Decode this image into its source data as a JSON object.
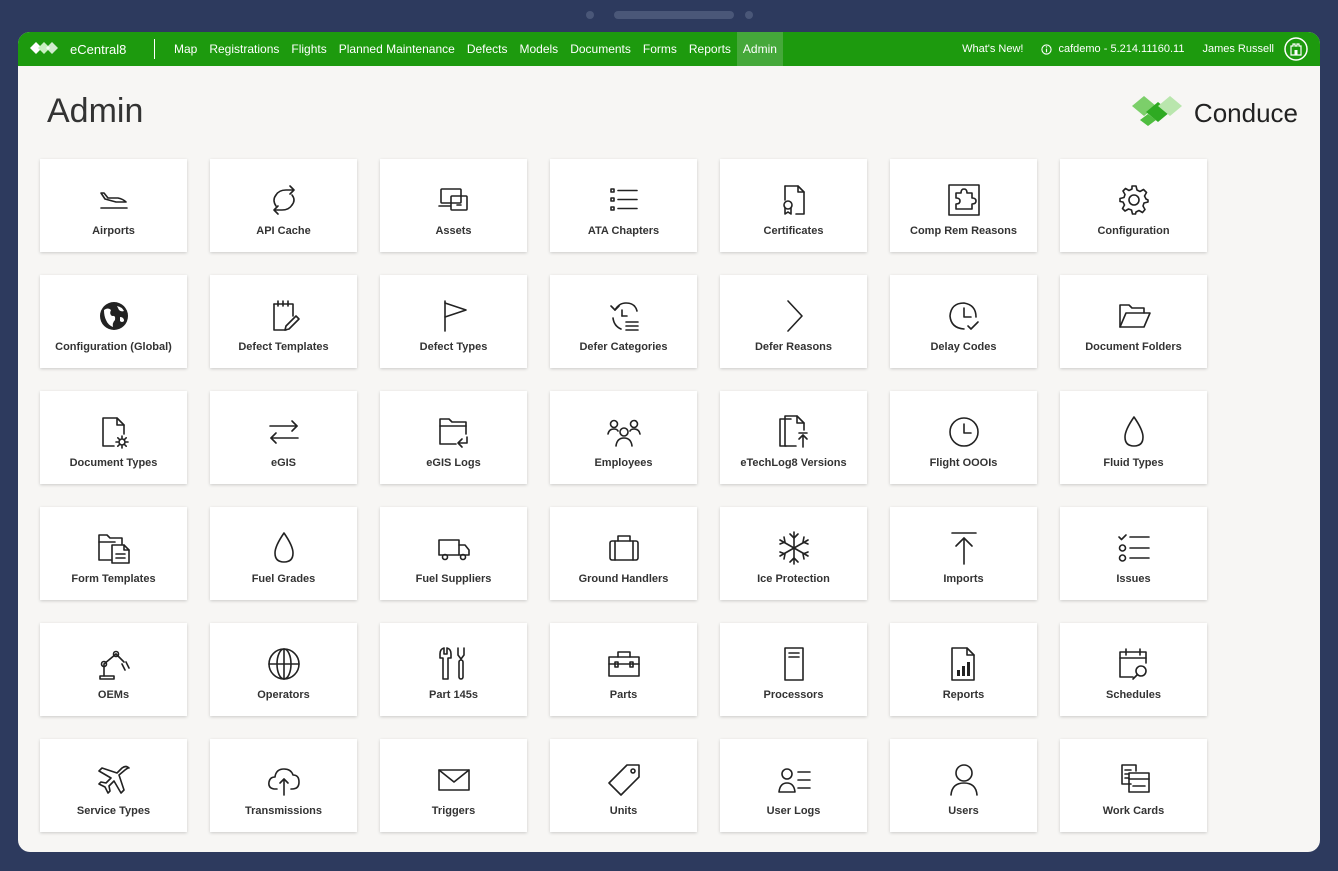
{
  "app": {
    "name": "eCentral8"
  },
  "nav": {
    "items": [
      "Map",
      "Registrations",
      "Flights",
      "Planned Maintenance",
      "Defects",
      "Models",
      "Documents",
      "Forms",
      "Reports",
      "Admin"
    ],
    "active": "Admin"
  },
  "header": {
    "whats_new": "What's New!",
    "version": "cafdemo - 5.214.11160.11",
    "user": "James Russell"
  },
  "page": {
    "title": "Admin"
  },
  "logo": {
    "text": "Conduce"
  },
  "colors": {
    "topbar": "#1d9a0e",
    "active_nav": "#45a83a",
    "frame": "#2d3a5e"
  },
  "tiles": [
    {
      "label": "Airports",
      "icon": "plane-landing-icon"
    },
    {
      "label": "API Cache",
      "icon": "refresh-icon"
    },
    {
      "label": "Assets",
      "icon": "devices-icon"
    },
    {
      "label": "ATA Chapters",
      "icon": "list-icon"
    },
    {
      "label": "Certificates",
      "icon": "certificate-icon"
    },
    {
      "label": "Comp Rem Reasons",
      "icon": "puzzle-icon"
    },
    {
      "label": "Configuration",
      "icon": "gear-icon"
    },
    {
      "label": "Configuration (Global)",
      "icon": "globe-filled-icon"
    },
    {
      "label": "Defect Templates",
      "icon": "note-edit-icon"
    },
    {
      "label": "Defect Types",
      "icon": "flag-icon"
    },
    {
      "label": "Defer Categories",
      "icon": "history-list-icon"
    },
    {
      "label": "Defer Reasons",
      "icon": "chevron-right-icon"
    },
    {
      "label": "Delay Codes",
      "icon": "clock-check-icon"
    },
    {
      "label": "Document Folders",
      "icon": "folder-open-icon"
    },
    {
      "label": "Document Types",
      "icon": "document-gear-icon"
    },
    {
      "label": "eGIS",
      "icon": "arrows-swap-icon"
    },
    {
      "label": "eGIS Logs",
      "icon": "folder-arrow-icon"
    },
    {
      "label": "Employees",
      "icon": "people-icon"
    },
    {
      "label": "eTechLog8 Versions",
      "icon": "document-upload-icon"
    },
    {
      "label": "Flight OOOIs",
      "icon": "clock-icon"
    },
    {
      "label": "Fluid Types",
      "icon": "drop-icon"
    },
    {
      "label": "Form Templates",
      "icon": "folder-document-icon"
    },
    {
      "label": "Fuel Grades",
      "icon": "drop-icon"
    },
    {
      "label": "Fuel Suppliers",
      "icon": "truck-icon"
    },
    {
      "label": "Ground Handlers",
      "icon": "briefcase-icon"
    },
    {
      "label": "Ice Protection",
      "icon": "snowflake-icon"
    },
    {
      "label": "Imports",
      "icon": "arrow-up-icon"
    },
    {
      "label": "Issues",
      "icon": "checklist-icon"
    },
    {
      "label": "OEMs",
      "icon": "robot-arm-icon"
    },
    {
      "label": "Operators",
      "icon": "globe-icon"
    },
    {
      "label": "Part 145s",
      "icon": "tools-icon"
    },
    {
      "label": "Parts",
      "icon": "toolbox-icon"
    },
    {
      "label": "Processors",
      "icon": "server-icon"
    },
    {
      "label": "Reports",
      "icon": "report-chart-icon"
    },
    {
      "label": "Schedules",
      "icon": "calendar-search-icon"
    },
    {
      "label": "Service Types",
      "icon": "airplane-icon"
    },
    {
      "label": "Transmissions",
      "icon": "cloud-upload-icon"
    },
    {
      "label": "Triggers",
      "icon": "envelope-icon"
    },
    {
      "label": "Units",
      "icon": "tag-icon"
    },
    {
      "label": "User Logs",
      "icon": "user-list-icon"
    },
    {
      "label": "Users",
      "icon": "user-icon"
    },
    {
      "label": "Work Cards",
      "icon": "cards-icon"
    }
  ]
}
